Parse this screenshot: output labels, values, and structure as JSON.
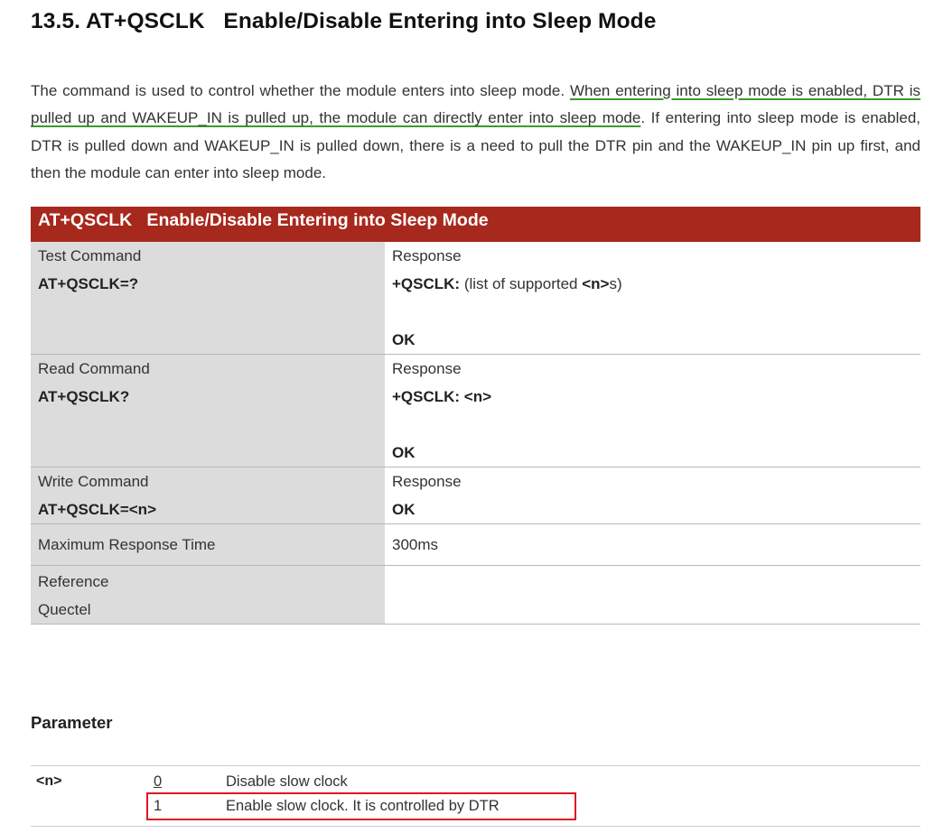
{
  "section": {
    "number": "13.5.",
    "title": "AT+QSCLK   Enable/Disable Entering into Sleep Mode"
  },
  "intro": {
    "before": "The command is used to control whether the module enters into sleep mode. ",
    "underlined": "When entering into sleep mode is enabled, DTR is pulled up and WAKEUP_IN is pulled up, the module can directly enter into sleep mode",
    "after": ". If entering into sleep mode is enabled, DTR is pulled down and WAKEUP_IN is pulled down, there is a need to pull the DTR pin and the WAKEUP_IN pin up first, and then the module can enter into sleep mode."
  },
  "command_table": {
    "header": "AT+QSCLK   Enable/Disable Entering into Sleep Mode",
    "test": {
      "label": "Test Command",
      "command": "AT+QSCLK=?",
      "response_label": "Response",
      "response_prefix": "+QSCLK:",
      "response_mid": " (list of supported ",
      "response_param": "<n>",
      "response_suffix": "s)",
      "ok": "OK"
    },
    "read": {
      "label": "Read Command",
      "command": "AT+QSCLK?",
      "response_label": "Response",
      "response_value": "+QSCLK: <n>",
      "ok": "OK"
    },
    "write": {
      "label": "Write Command",
      "command": "AT+QSCLK=<n>",
      "response_label": "Response",
      "ok": "OK"
    },
    "max_time": {
      "label": "Maximum Response Time",
      "value": "300ms"
    },
    "reference": {
      "label": "Reference",
      "value": "Quectel"
    }
  },
  "parameter": {
    "title": "Parameter",
    "name": "<n>",
    "values": [
      {
        "value": "0",
        "description": "Disable slow clock"
      },
      {
        "value": "1",
        "description": "Enable slow clock. It is controlled by DTR"
      }
    ]
  },
  "colors": {
    "table_header": "#a7281c",
    "label_cell": "#dcdcdc",
    "underline": "#3a9a2a",
    "highlight_box": "#e0141e"
  }
}
